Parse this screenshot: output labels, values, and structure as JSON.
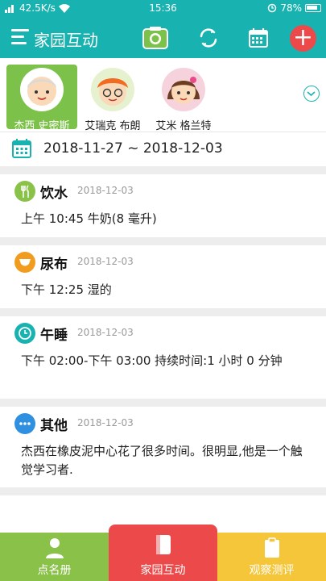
{
  "status_bar": {
    "network": "42.5K/s",
    "time": "15:36",
    "battery": "78%"
  },
  "header": {
    "title": "家园互动",
    "icons": [
      "menu-icon",
      "camera-icon",
      "refresh-icon",
      "calendar-icon",
      "plus-icon"
    ]
  },
  "kids": [
    {
      "name": "杰西 史密斯",
      "selected": true,
      "hair": "#ececec",
      "accent": "#7cc24a"
    },
    {
      "name": "艾瑞克 布朗",
      "selected": false,
      "hair": "#f26b21",
      "accent": "#cde8a8"
    },
    {
      "name": "艾米 格兰特",
      "selected": false,
      "hair": "#6b3e24",
      "accent": "#f6c7d1"
    }
  ],
  "date_range": "2018-11-27 ~ 2018-12-03",
  "records": [
    {
      "type": "饮水",
      "date": "2018-12-03",
      "body": "上午 10:45 牛奶(8 毫升)",
      "icon": "fork-knife-icon",
      "color": "#8ac249"
    },
    {
      "type": "尿布",
      "date": "2018-12-03",
      "body": "下午 12:25 湿的",
      "icon": "diaper-icon",
      "color": "#f29c1f"
    },
    {
      "type": "午睡",
      "date": "2018-12-03",
      "body": "下午 02:00-下午 03:00 持续时间:1 小时 0 分钟",
      "icon": "clock-icon",
      "color": "#18b3b0"
    },
    {
      "type": "其他",
      "date": "2018-12-03",
      "body": "杰西在橡皮泥中心花了很多时间。很明显,他是一个触觉学习者.",
      "icon": "more-dots-icon",
      "color": "#2f8fe0"
    }
  ],
  "tabs": [
    {
      "label": "点名册",
      "icon": "person-icon"
    },
    {
      "label": "家园互动",
      "icon": "notebook-icon"
    },
    {
      "label": "观察测评",
      "icon": "clipboard-icon"
    }
  ],
  "colors": {
    "teal": "#18b3b0",
    "red": "#ec4a4a",
    "green": "#8ac249",
    "yellow": "#f5c53a"
  }
}
